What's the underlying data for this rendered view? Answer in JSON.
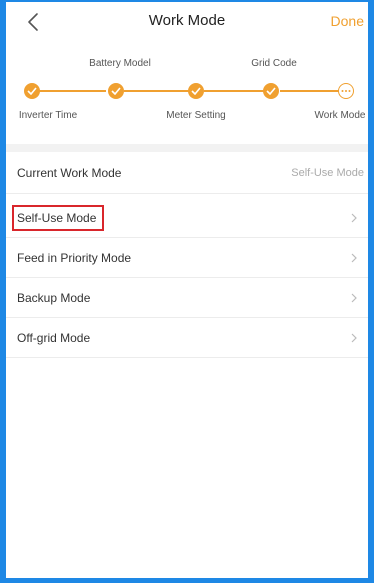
{
  "header": {
    "title": "Work Mode",
    "done_label": "Done",
    "back_icon": "chevron-left-icon"
  },
  "steps": {
    "top_labels": [
      "Battery Model",
      "Grid Code"
    ],
    "bottom_labels": [
      "Inverter Time",
      "Meter Setting",
      "Work Mode"
    ],
    "accent_color": "#f0a030"
  },
  "current": {
    "label": "Current Work Mode",
    "value": "Self-Use Mode"
  },
  "modes": [
    {
      "label": "Self-Use Mode",
      "highlighted": true
    },
    {
      "label": "Feed in Priority Mode",
      "highlighted": false
    },
    {
      "label": "Backup Mode",
      "highlighted": false
    },
    {
      "label": "Off-grid Mode",
      "highlighted": false
    }
  ],
  "colors": {
    "frame": "#1e88e5",
    "highlight": "#d9262b",
    "done": "#f0a030"
  }
}
